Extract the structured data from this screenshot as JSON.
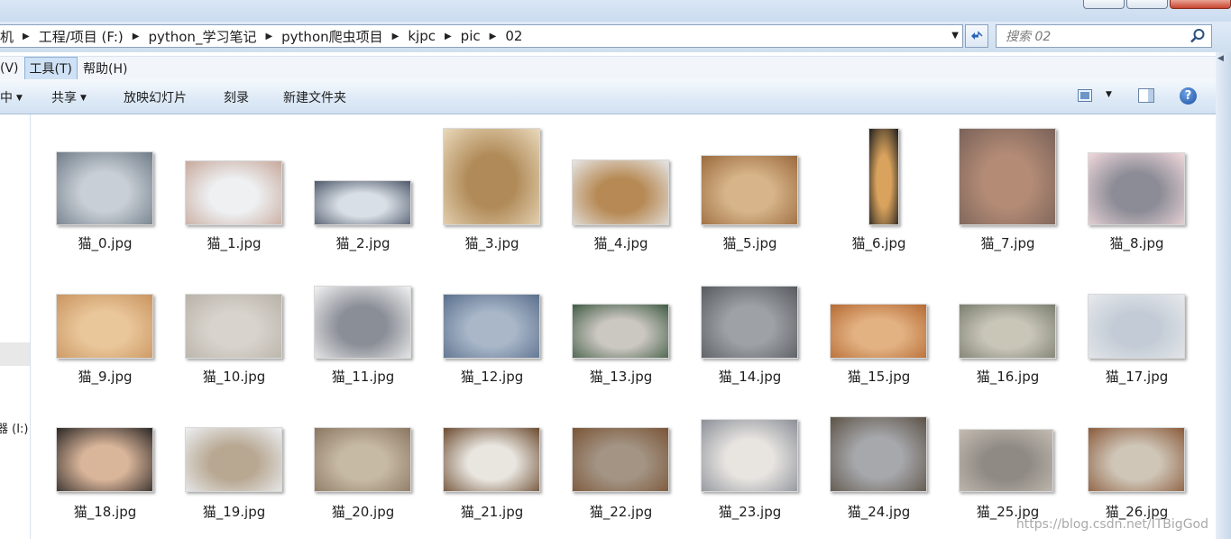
{
  "address": {
    "crumbs": [
      "机",
      "工程/项目 (F:)",
      "python_学习笔记",
      "python爬虫项目",
      "kjpc",
      "pic",
      "02"
    ]
  },
  "search": {
    "placeholder": "搜索 02"
  },
  "menu": {
    "items": [
      "(V)",
      "工具(T)",
      "帮助(H)"
    ],
    "active_index": 1
  },
  "toolbar": {
    "partial_label": "中",
    "share_label": "共享",
    "slideshow_label": "放映幻灯片",
    "burn_label": "刻录",
    "new_folder_label": "新建文件夹",
    "help_label": "?"
  },
  "nav": {
    "drive_label": "器 (I:)"
  },
  "files": [
    {
      "name": "猫_0.jpg",
      "c1": "#6f7c88",
      "c2": "#c9cfd6"
    },
    {
      "name": "猫_1.jpg",
      "c1": "#c7a89b",
      "c2": "#eef0f2"
    },
    {
      "name": "猫_2.jpg",
      "c1": "#4c5869",
      "c2": "#d9dfe6"
    },
    {
      "name": "猫_3.jpg",
      "c1": "#e9d9bb",
      "c2": "#b08a58"
    },
    {
      "name": "猫_4.jpg",
      "c1": "#e6e6e6",
      "c2": "#b78a55"
    },
    {
      "name": "猫_5.jpg",
      "c1": "#9a6a3c",
      "c2": "#d7b48a"
    },
    {
      "name": "猫_6.jpg",
      "c1": "#1d1d1d",
      "c2": "#d9a35d"
    },
    {
      "name": "猫_7.jpg",
      "c1": "#7a6259",
      "c2": "#b48c76"
    },
    {
      "name": "猫_8.jpg",
      "c1": "#f0d8dc",
      "c2": "#8c8c96"
    },
    {
      "name": "猫_9.jpg",
      "c1": "#c9945f",
      "c2": "#eac79b"
    },
    {
      "name": "猫_10.jpg",
      "c1": "#b8b2a8",
      "c2": "#d8d3cc"
    },
    {
      "name": "猫_11.jpg",
      "c1": "#f2f2f2",
      "c2": "#8a8e96"
    },
    {
      "name": "猫_12.jpg",
      "c1": "#5a6f8c",
      "c2": "#a9b7c9"
    },
    {
      "name": "猫_13.jpg",
      "c1": "#3f5b43",
      "c2": "#cbc7c1"
    },
    {
      "name": "猫_14.jpg",
      "c1": "#575b60",
      "c2": "#9ea2a6"
    },
    {
      "name": "猫_15.jpg",
      "c1": "#b56a33",
      "c2": "#e3b283"
    },
    {
      "name": "猫_16.jpg",
      "c1": "#7a7d6f",
      "c2": "#c9c6b8"
    },
    {
      "name": "猫_17.jpg",
      "c1": "#e7e9ec",
      "c2": "#c3ccd6"
    },
    {
      "name": "猫_18.jpg",
      "c1": "#2a2624",
      "c2": "#d9b59a"
    },
    {
      "name": "猫_19.jpg",
      "c1": "#eceff3",
      "c2": "#b8a892"
    },
    {
      "name": "猫_20.jpg",
      "c1": "#8a7660",
      "c2": "#c7baa5"
    },
    {
      "name": "猫_21.jpg",
      "c1": "#6b4a2f",
      "c2": "#e9e6e0"
    },
    {
      "name": "猫_22.jpg",
      "c1": "#7a5436",
      "c2": "#a39484"
    },
    {
      "name": "猫_23.jpg",
      "c1": "#8b8f98",
      "c2": "#e8e5e1"
    },
    {
      "name": "猫_24.jpg",
      "c1": "#5c5246",
      "c2": "#a7a8ac"
    },
    {
      "name": "猫_25.jpg",
      "c1": "#c4bcb2",
      "c2": "#8f8a84"
    },
    {
      "name": "猫_26.jpg",
      "c1": "#8a5a3a",
      "c2": "#cfc6b8"
    }
  ],
  "watermark": "https://blog.csdn.net/ITBigGod"
}
